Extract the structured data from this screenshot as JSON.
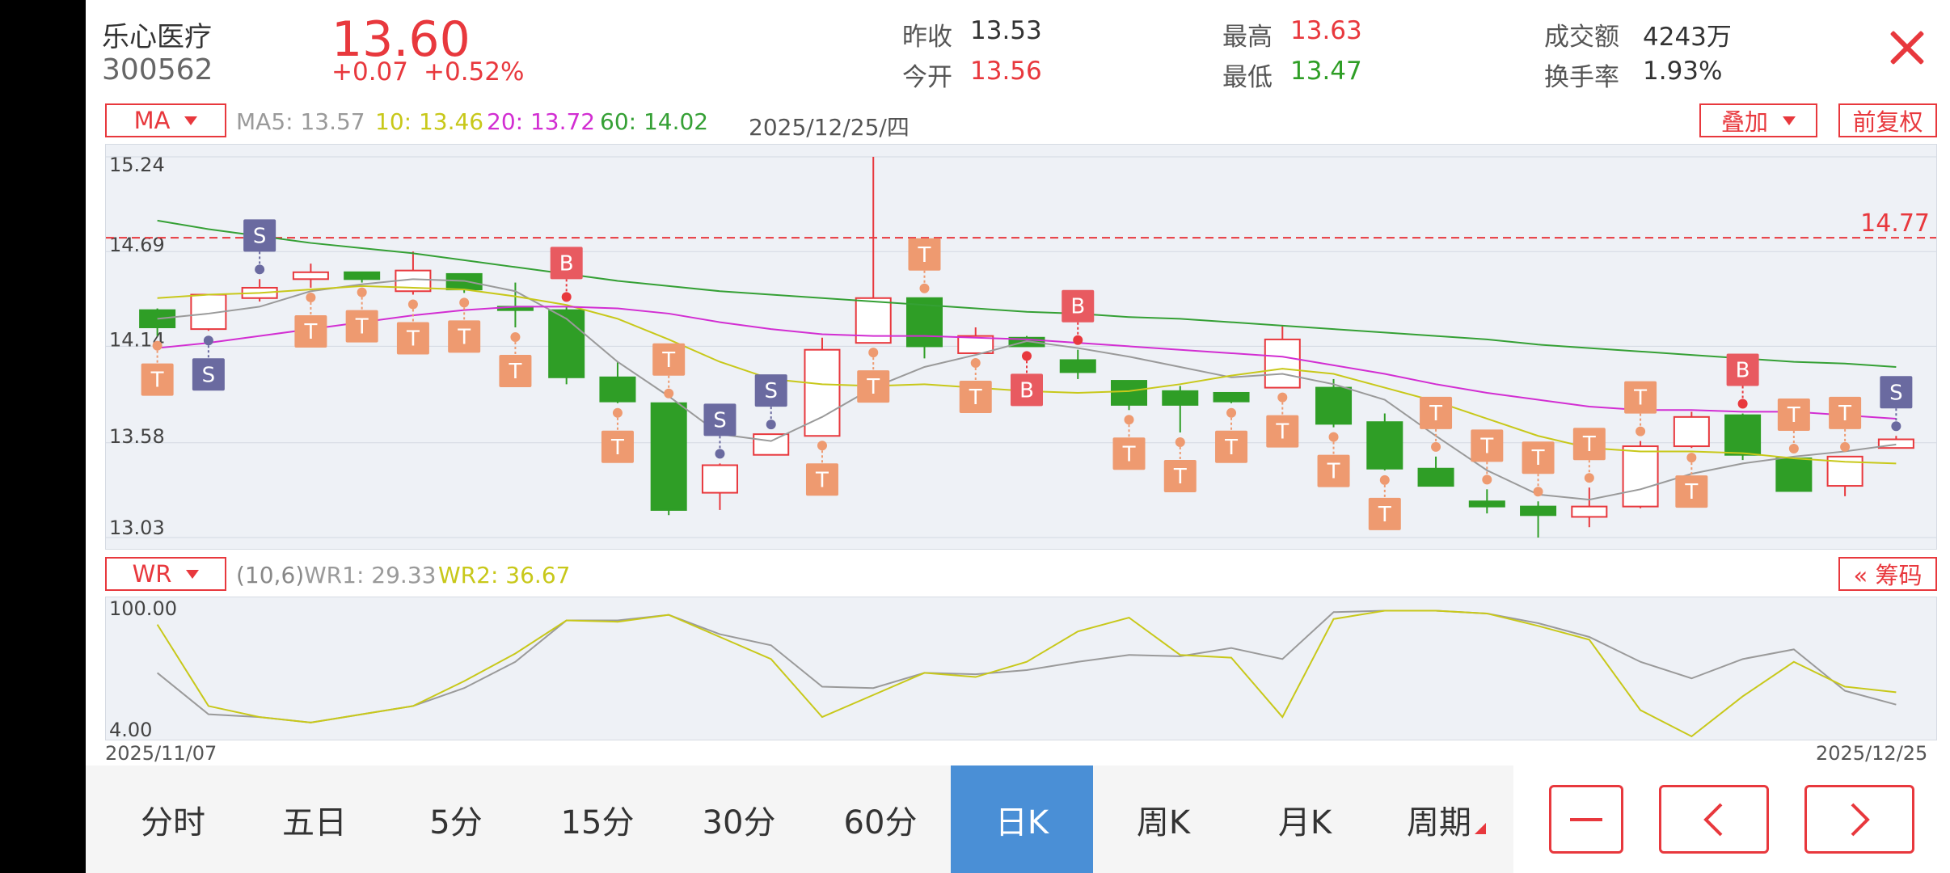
{
  "header": {
    "name": "乐心医疗",
    "code": "300562",
    "price": "13.60",
    "change": "+0.07",
    "change_pct": "+0.52%",
    "prev_close_label": "昨收",
    "prev_close": "13.53",
    "open_label": "今开",
    "open": "13.56",
    "high_label": "最高",
    "high": "13.63",
    "low_label": "最低",
    "low": "13.47",
    "amount_label": "成交额",
    "amount": "4243万",
    "turnover_label": "换手率",
    "turnover": "1.93%"
  },
  "ma_bar": {
    "selector": "MA",
    "ma5": "MA5: 13.57",
    "ma10": "10: 13.46",
    "ma20": "20: 13.72",
    "ma60": "60: 14.02",
    "date": "2025/12/25/四",
    "overlay_button": "叠加",
    "adjust_button": "前复权"
  },
  "wr_bar": {
    "selector": "WR",
    "params": "(10,6)",
    "wr1": "WR1: 29.33",
    "wr2": "WR2: 36.67",
    "chips_button": "« 筹码"
  },
  "tabs": [
    "分时",
    "五日",
    "5分",
    "15分",
    "30分",
    "60分",
    "日K",
    "周K",
    "月K",
    "周期"
  ],
  "active_tab": "日K",
  "colors": {
    "up": "#e8383d",
    "down": "#2f9e26",
    "ma5": "#9a9a9a",
    "ma10": "#c8c81a",
    "ma20": "#d22ed2",
    "ma60": "#35a035",
    "wr1": "#9a9a9a",
    "wr2": "#c8c81a",
    "accent": "#4a8fd6"
  },
  "chart_data": [
    {
      "type": "candlestick",
      "x_start": "2025/11/07",
      "x_end": "2025/12/25",
      "y_ticks": [
        "15.24",
        "14.69",
        "14.14",
        "13.58",
        "13.03"
      ],
      "ylim": [
        13.03,
        15.24
      ],
      "reference_line": 14.77,
      "reference_label": "14.77",
      "candles": [
        {
          "o": 14.35,
          "h": 14.36,
          "l": 14.2,
          "c": 14.25
        },
        {
          "o": 14.24,
          "h": 14.44,
          "l": 14.23,
          "c": 14.44
        },
        {
          "o": 14.42,
          "h": 14.53,
          "l": 14.4,
          "c": 14.48
        },
        {
          "o": 14.53,
          "h": 14.62,
          "l": 14.48,
          "c": 14.57
        },
        {
          "o": 14.57,
          "h": 14.57,
          "l": 14.51,
          "c": 14.53
        },
        {
          "o": 14.46,
          "h": 14.69,
          "l": 14.44,
          "c": 14.58
        },
        {
          "o": 14.56,
          "h": 14.56,
          "l": 14.45,
          "c": 14.47
        },
        {
          "o": 14.37,
          "h": 14.51,
          "l": 14.25,
          "c": 14.35
        },
        {
          "o": 14.35,
          "h": 14.37,
          "l": 13.92,
          "c": 13.96
        },
        {
          "o": 13.96,
          "h": 14.05,
          "l": 13.81,
          "c": 13.82
        },
        {
          "o": 13.81,
          "h": 13.81,
          "l": 13.16,
          "c": 13.19
        },
        {
          "o": 13.29,
          "h": 13.46,
          "l": 13.19,
          "c": 13.45
        },
        {
          "o": 13.51,
          "h": 13.61,
          "l": 13.51,
          "c": 13.63
        },
        {
          "o": 13.62,
          "h": 14.19,
          "l": 13.62,
          "c": 14.12
        },
        {
          "o": 14.16,
          "h": 15.24,
          "l": 14.16,
          "c": 14.42
        },
        {
          "o": 14.42,
          "h": 14.42,
          "l": 14.07,
          "c": 14.14
        },
        {
          "o": 14.1,
          "h": 14.25,
          "l": 14.1,
          "c": 14.2
        },
        {
          "o": 14.19,
          "h": 14.2,
          "l": 14.14,
          "c": 14.14
        },
        {
          "o": 14.06,
          "h": 14.12,
          "l": 13.95,
          "c": 13.99
        },
        {
          "o": 13.94,
          "h": 13.94,
          "l": 13.77,
          "c": 13.8
        },
        {
          "o": 13.88,
          "h": 13.91,
          "l": 13.64,
          "c": 13.8
        },
        {
          "o": 13.87,
          "h": 13.87,
          "l": 13.81,
          "c": 13.82
        },
        {
          "o": 13.9,
          "h": 14.26,
          "l": 13.9,
          "c": 14.18
        },
        {
          "o": 13.9,
          "h": 13.95,
          "l": 13.67,
          "c": 13.69
        },
        {
          "o": 13.7,
          "h": 13.75,
          "l": 13.42,
          "c": 13.43
        },
        {
          "o": 13.43,
          "h": 13.5,
          "l": 13.4,
          "c": 13.33
        },
        {
          "o": 13.24,
          "h": 13.31,
          "l": 13.17,
          "c": 13.21
        },
        {
          "o": 13.21,
          "h": 13.24,
          "l": 13.03,
          "c": 13.16
        },
        {
          "o": 13.15,
          "h": 13.32,
          "l": 13.09,
          "c": 13.21
        },
        {
          "o": 13.21,
          "h": 13.59,
          "l": 13.2,
          "c": 13.56
        },
        {
          "o": 13.56,
          "h": 13.76,
          "l": 13.55,
          "c": 13.73
        },
        {
          "o": 13.74,
          "h": 13.75,
          "l": 13.48,
          "c": 13.51
        },
        {
          "o": 13.49,
          "h": 13.49,
          "l": 13.3,
          "c": 13.3
        },
        {
          "o": 13.33,
          "h": 13.5,
          "l": 13.27,
          "c": 13.5
        },
        {
          "o": 13.55,
          "h": 13.62,
          "l": 13.55,
          "c": 13.6
        }
      ],
      "ma": {
        "ma5": [
          14.3,
          14.33,
          14.37,
          14.46,
          14.5,
          14.53,
          14.52,
          14.46,
          14.3,
          14.05,
          13.85,
          13.63,
          13.59,
          13.73,
          13.9,
          14.02,
          14.09,
          14.17,
          14.13,
          14.08,
          14.02,
          13.96,
          13.98,
          13.92,
          13.83,
          13.62,
          13.42,
          13.28,
          13.25,
          13.31,
          13.4,
          13.46,
          13.5,
          13.53,
          13.57
        ],
        "ma10": [
          14.42,
          14.44,
          14.45,
          14.47,
          14.49,
          14.48,
          14.47,
          14.43,
          14.38,
          14.3,
          14.18,
          14.05,
          13.95,
          13.92,
          13.91,
          13.92,
          13.9,
          13.88,
          13.87,
          13.88,
          13.92,
          13.97,
          14.01,
          13.98,
          13.9,
          13.82,
          13.72,
          13.62,
          13.55,
          13.53,
          13.53,
          13.52,
          13.49,
          13.47,
          13.46
        ],
        "ma20": [
          14.13,
          14.16,
          14.2,
          14.24,
          14.28,
          14.32,
          14.35,
          14.37,
          14.37,
          14.36,
          14.33,
          14.28,
          14.24,
          14.21,
          14.2,
          14.2,
          14.19,
          14.18,
          14.16,
          14.14,
          14.12,
          14.1,
          14.08,
          14.03,
          13.98,
          13.92,
          13.87,
          13.83,
          13.79,
          13.77,
          13.77,
          13.76,
          13.76,
          13.74,
          13.72
        ],
        "ma60": [
          14.87,
          14.82,
          14.78,
          14.74,
          14.71,
          14.68,
          14.64,
          14.6,
          14.56,
          14.52,
          14.49,
          14.46,
          14.44,
          14.42,
          14.4,
          14.38,
          14.36,
          14.34,
          14.33,
          14.31,
          14.3,
          14.28,
          14.26,
          14.24,
          14.22,
          14.2,
          14.18,
          14.15,
          14.13,
          14.11,
          14.09,
          14.07,
          14.05,
          14.04,
          14.02
        ]
      },
      "signals": [
        {
          "i": 0,
          "t": "T",
          "side": "below"
        },
        {
          "i": 1,
          "t": "S",
          "side": "below"
        },
        {
          "i": 2,
          "t": "S",
          "side": "above"
        },
        {
          "i": 3,
          "t": "T",
          "side": "below"
        },
        {
          "i": 4,
          "t": "T",
          "side": "below"
        },
        {
          "i": 5,
          "t": "T",
          "side": "below"
        },
        {
          "i": 6,
          "t": "T",
          "side": "below"
        },
        {
          "i": 7,
          "t": "T",
          "side": "below"
        },
        {
          "i": 8,
          "t": "B",
          "side": "above"
        },
        {
          "i": 9,
          "t": "T",
          "side": "below"
        },
        {
          "i": 10,
          "t": "T",
          "side": "above"
        },
        {
          "i": 11,
          "t": "S",
          "side": "above"
        },
        {
          "i": 12,
          "t": "S",
          "side": "above"
        },
        {
          "i": 13,
          "t": "T",
          "side": "below"
        },
        {
          "i": 14,
          "t": "T",
          "side": "below"
        },
        {
          "i": 15,
          "t": "T",
          "side": "above"
        },
        {
          "i": 16,
          "t": "T",
          "side": "below"
        },
        {
          "i": 17,
          "t": "B",
          "side": "below"
        },
        {
          "i": 18,
          "t": "B",
          "side": "above"
        },
        {
          "i": 19,
          "t": "T",
          "side": "below"
        },
        {
          "i": 20,
          "t": "T",
          "side": "below"
        },
        {
          "i": 21,
          "t": "T",
          "side": "below"
        },
        {
          "i": 22,
          "t": "T",
          "side": "below"
        },
        {
          "i": 23,
          "t": "T",
          "side": "below"
        },
        {
          "i": 24,
          "t": "T",
          "side": "below"
        },
        {
          "i": 25,
          "t": "T",
          "side": "above"
        },
        {
          "i": 26,
          "t": "T",
          "side": "above"
        },
        {
          "i": 27,
          "t": "T",
          "side": "above"
        },
        {
          "i": 28,
          "t": "T",
          "side": "above"
        },
        {
          "i": 29,
          "t": "T",
          "side": "above"
        },
        {
          "i": 30,
          "t": "T",
          "side": "below"
        },
        {
          "i": 31,
          "t": "B",
          "side": "above"
        },
        {
          "i": 32,
          "t": "T",
          "side": "above"
        },
        {
          "i": 33,
          "t": "T",
          "side": "above"
        },
        {
          "i": 34,
          "t": "S",
          "side": "above"
        }
      ]
    },
    {
      "type": "line",
      "y_ticks": [
        "100.00",
        "4.00"
      ],
      "ylim": [
        4,
        100
      ],
      "series": [
        {
          "name": "WR1",
          "values": [
            50,
            20,
            18,
            14,
            20,
            26,
            39,
            58,
            88,
            88,
            92,
            78,
            70,
            40,
            39,
            50,
            49,
            52,
            58,
            63,
            62,
            68,
            60,
            94,
            95,
            95,
            93,
            86,
            76,
            58,
            46,
            60,
            67,
            37,
            27
          ]
        },
        {
          "name": "WR2",
          "values": [
            85,
            26,
            18,
            14,
            20,
            26,
            44,
            64,
            88,
            87,
            92,
            76,
            60,
            18,
            34,
            50,
            47,
            58,
            80,
            90,
            63,
            61,
            18,
            89,
            95,
            95,
            93,
            84,
            74,
            23,
            4,
            33,
            58,
            40,
            36
          ]
        }
      ]
    }
  ]
}
